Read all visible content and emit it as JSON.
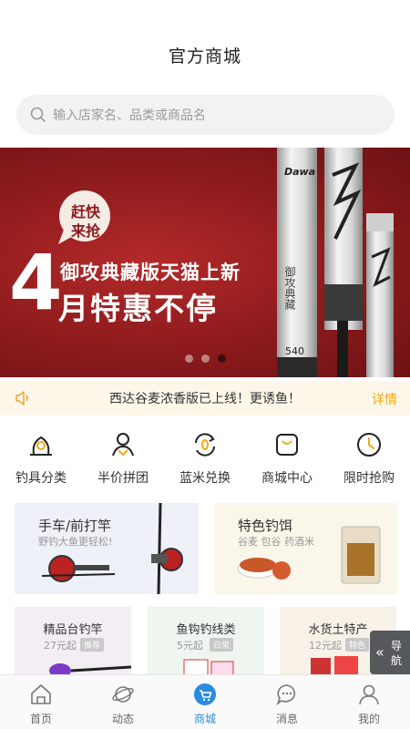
{
  "header": {
    "title": "官方商城"
  },
  "search": {
    "placeholder": "输入店家名、品类或商品名"
  },
  "banner": {
    "bubble_line1": "赶快",
    "bubble_line2": "来抢",
    "big_number": "4",
    "subtitle": "御攻典藏版天猫上新",
    "headline": "月特惠不停",
    "rod_text_a": "御攻典藏",
    "rod_number": "540",
    "rod_brand": "Dawa",
    "slides_total": 3,
    "slide_active": 3
  },
  "notice": {
    "text": "西达谷麦浓香版已上线！更诱鱼！",
    "more": "详情"
  },
  "categories": [
    {
      "label": "钓具分类",
      "icon": "fishing-gear-icon"
    },
    {
      "label": "半价拼团",
      "icon": "group-buy-icon"
    },
    {
      "label": "蓝米兑换",
      "icon": "exchange-icon"
    },
    {
      "label": "商城中心",
      "icon": "mall-center-icon"
    },
    {
      "label": "限时抢购",
      "icon": "clock-icon"
    }
  ],
  "promo_cards": [
    {
      "title": "手车/前打竿",
      "subtitle": "野钓大鱼更轻松!"
    },
    {
      "title": "特色钓饵",
      "subtitle": "谷麦  包谷  药酒米"
    }
  ],
  "small_cards": [
    {
      "title": "精品台钓竿",
      "price": "27元起",
      "tag": "推荐"
    },
    {
      "title": "鱼钩钓线类",
      "price": "5元起",
      "tag": "日常"
    },
    {
      "title": "水货土特产",
      "price": "12元起",
      "tag": "特色"
    }
  ],
  "guide": {
    "line1": "导",
    "line2": "航"
  },
  "tabs": [
    {
      "label": "首页",
      "icon": "home-icon"
    },
    {
      "label": "动态",
      "icon": "planet-icon"
    },
    {
      "label": "商城",
      "icon": "cart-icon",
      "active": true
    },
    {
      "label": "消息",
      "icon": "message-icon"
    },
    {
      "label": "我的",
      "icon": "user-icon"
    }
  ],
  "colors": {
    "accent": "#f2a716",
    "tab_active": "#2a8be0",
    "banner_red": "#8c1a1c"
  }
}
